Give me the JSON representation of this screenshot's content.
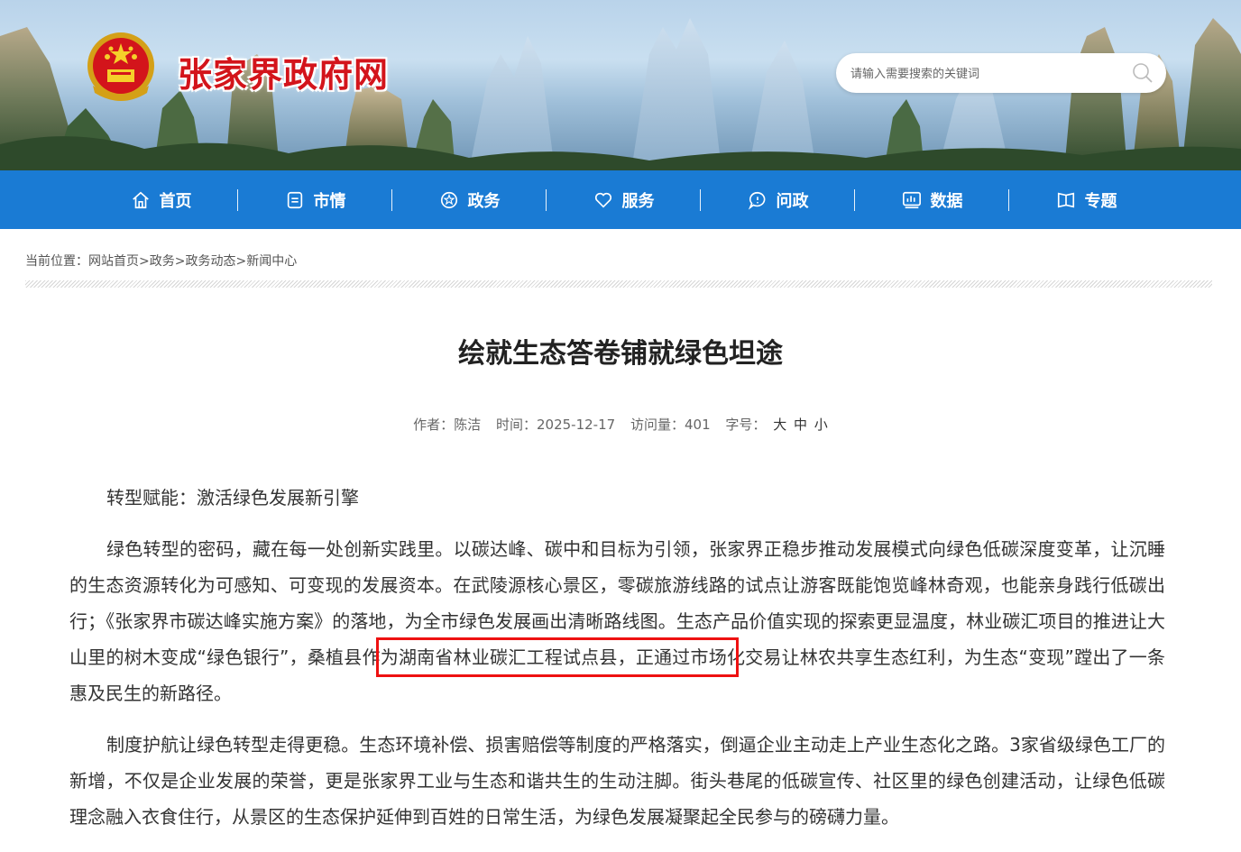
{
  "header": {
    "site_name": "张家界政府网",
    "search": {
      "placeholder": "请输入需要搜索的关键词",
      "value": ""
    }
  },
  "nav": [
    {
      "label": "首页",
      "icon": "home-icon"
    },
    {
      "label": "市情",
      "icon": "document-icon"
    },
    {
      "label": "政务",
      "icon": "emblem-badge-icon"
    },
    {
      "label": "服务",
      "icon": "heart-icon"
    },
    {
      "label": "问政",
      "icon": "chat-bubble-icon"
    },
    {
      "label": "数据",
      "icon": "bar-chart-icon"
    },
    {
      "label": "专题",
      "icon": "book-icon"
    }
  ],
  "breadcrumb": {
    "prefix": "当前位置：",
    "items": [
      "网站首页",
      "政务",
      "政务动态",
      "新闻中心"
    ],
    "separator": ">"
  },
  "article": {
    "title": "绘就生态答卷铺就绿色坦途",
    "meta": {
      "author_label": "作者：",
      "author": "陈洁",
      "time_label": "时间：",
      "time": "2025-12-17",
      "views_label": "访问量：",
      "views": "401",
      "fontsize_label": "字号：",
      "fontsize_options": [
        "大",
        "中",
        "小"
      ]
    },
    "paragraphs": [
      "转型赋能：激活绿色发展新引擎",
      "绿色转型的密码，藏在每一处创新实践里。以碳达峰、碳中和目标为引领，张家界正稳步推动发展模式向绿色低碳深度变革，让沉睡的生态资源转化为可感知、可变现的发展资本。在武陵源核心景区，零碳旅游线路的试点让游客既能饱览峰林奇观，也能亲身践行低碳出行；《张家界市碳达峰实施方案》的落地，为全市绿色发展画出清晰路线图。生态产品价值实现的探索更显温度，林业碳汇项目的推进让大山里的树木变成“绿色银行”，桑植县作为湖南省林业碳汇工程试点县，正通过市场化交易让林农共享生态红利，为生态“变现”蹚出了一条惠及民生的新路径。",
      "制度护航让绿色转型走得更稳。生态环境补偿、损害赔偿等制度的严格落实，倒逼企业主动走上产业生态化之路。3家省级绿色工厂的新增，不仅是企业发展的荣誉，更是张家界工业与生态和谐共生的生动注脚。街头巷尾的低碳宣传、社区里的绿色创建活动，让绿色低碳理念融入衣食住行，从景区的生态保护延伸到百姓的日常生活，为绿色发展凝聚起全民参与的磅礴力量。"
    ]
  },
  "colors": {
    "nav_bg": "#1a7bd4",
    "site_name": "#d3141b",
    "highlight": "#ee1111"
  }
}
